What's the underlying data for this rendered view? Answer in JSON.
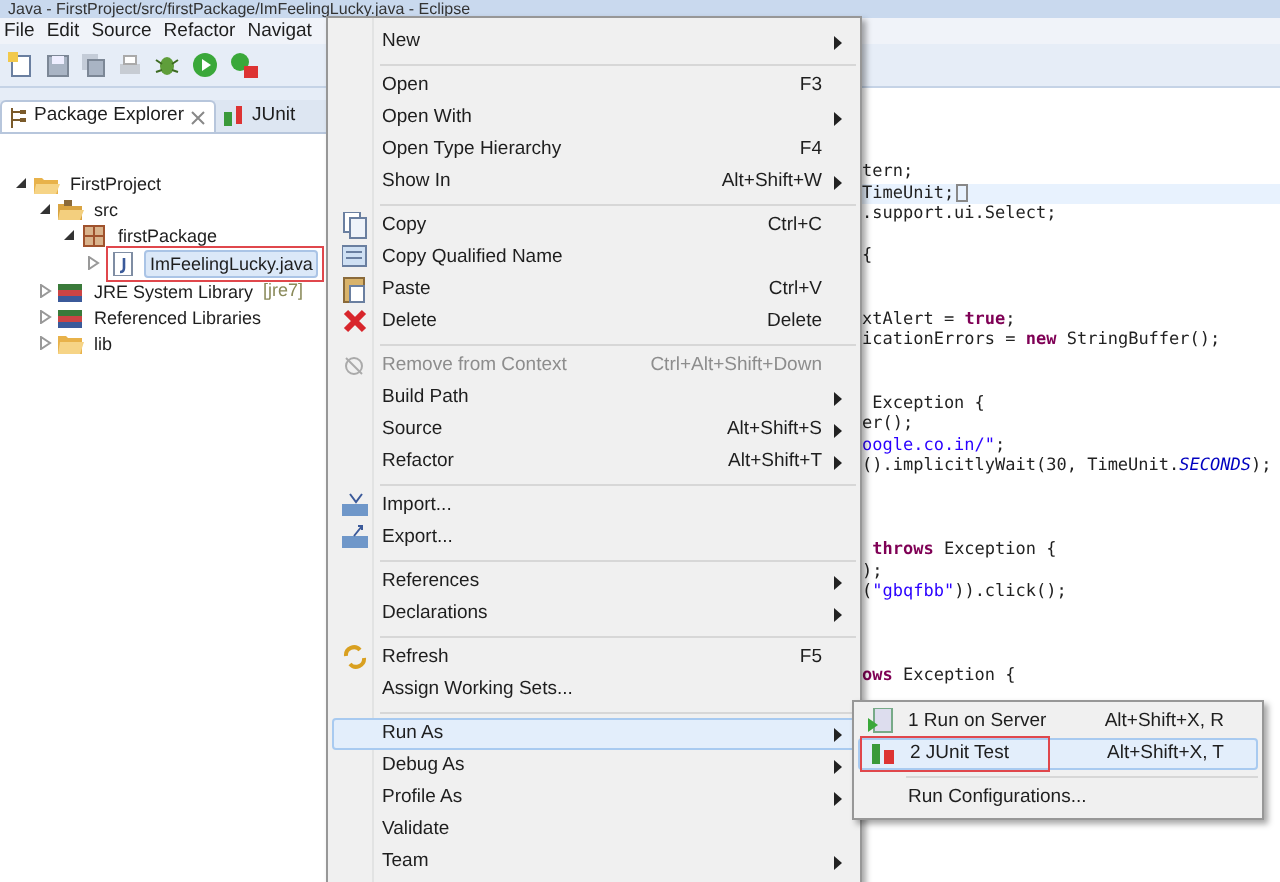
{
  "window": {
    "title": "Java - FirstProject/src/firstPackage/ImFeelingLucky.java - Eclipse"
  },
  "menu_bar": [
    "File",
    "Edit",
    "Source",
    "Refactor",
    "Navigat"
  ],
  "package_explorer": {
    "tabs": [
      {
        "label": "Package Explorer",
        "selected": true
      },
      {
        "label": "JUnit",
        "selected": false
      }
    ],
    "tree": [
      {
        "kind": "project",
        "label": "FirstProject",
        "expanded": true,
        "children": [
          {
            "kind": "source-folder",
            "label": "src",
            "expanded": true,
            "children": [
              {
                "kind": "package",
                "label": "firstPackage",
                "expanded": true,
                "children": [
                  {
                    "kind": "java-file",
                    "label": "ImFeelingLucky.java",
                    "expanded": false,
                    "selected": true,
                    "outlined": true
                  }
                ]
              }
            ]
          },
          {
            "kind": "library",
            "label": "JRE System Library",
            "decoration": "[jre7]",
            "expanded": false
          },
          {
            "kind": "library",
            "label": "Referenced Libraries",
            "expanded": false
          },
          {
            "kind": "folder",
            "label": "lib",
            "expanded": false
          }
        ]
      }
    ]
  },
  "editor": {
    "lines": [
      {
        "tokens": [
          {
            "kind": "plain",
            "text": "tern;"
          }
        ]
      },
      {
        "current": true,
        "tokens": [
          {
            "kind": "plain",
            "text": "TimeUnit;"
          }
        ]
      },
      {
        "tokens": [
          {
            "kind": "plain",
            "text": ".support.ui.Select;"
          }
        ]
      },
      {
        "blank": true
      },
      {
        "tokens": [
          {
            "kind": "plain",
            "text": "{"
          }
        ]
      },
      {
        "blank": true
      },
      {
        "blank": true
      },
      {
        "tokens": [
          {
            "kind": "plain",
            "text": "xtAlert = "
          },
          {
            "kind": "keyword",
            "text": "true"
          },
          {
            "kind": "plain",
            "text": ";"
          }
        ]
      },
      {
        "tokens": [
          {
            "kind": "plain",
            "text": "icationErrors = "
          },
          {
            "kind": "keyword",
            "text": "new"
          },
          {
            "kind": "plain",
            "text": " StringBuffer();"
          }
        ]
      },
      {
        "blank": true
      },
      {
        "blank": true
      },
      {
        "tokens": [
          {
            "kind": "plain",
            "text": " Exception {"
          }
        ]
      },
      {
        "tokens": [
          {
            "kind": "plain",
            "text": "er();"
          }
        ]
      },
      {
        "tokens": [
          {
            "kind": "string",
            "text": "oogle.co.in/\""
          },
          {
            "kind": "plain",
            "text": ";"
          }
        ]
      },
      {
        "tokens": [
          {
            "kind": "plain",
            "text": "().implicitlyWait(30, TimeUnit."
          },
          {
            "kind": "constant",
            "text": "SECONDS"
          },
          {
            "kind": "plain",
            "text": ");"
          }
        ]
      },
      {
        "blank": true
      },
      {
        "blank": true
      },
      {
        "blank": true
      },
      {
        "tokens": [
          {
            "kind": "keyword",
            "text": " throws"
          },
          {
            "kind": "plain",
            "text": " Exception {"
          }
        ]
      },
      {
        "tokens": [
          {
            "kind": "plain",
            "text": ");"
          }
        ]
      },
      {
        "tokens": [
          {
            "kind": "plain",
            "text": "("
          },
          {
            "kind": "string",
            "text": "\"gbqfbb\""
          },
          {
            "kind": "plain",
            "text": ")).click();"
          }
        ]
      },
      {
        "blank": true
      },
      {
        "blank": true
      },
      {
        "blank": true
      },
      {
        "tokens": [
          {
            "kind": "keyword",
            "text": "ows"
          },
          {
            "kind": "plain",
            "text": " Exception {"
          }
        ]
      }
    ]
  },
  "context_menu": {
    "items": [
      {
        "kind": "item",
        "label": "New",
        "submenu": true
      },
      {
        "kind": "separator"
      },
      {
        "kind": "item",
        "label": "Open",
        "shortcut": "F3"
      },
      {
        "kind": "item",
        "label": "Open With",
        "submenu": true
      },
      {
        "kind": "item",
        "label": "Open Type Hierarchy",
        "shortcut": "F4"
      },
      {
        "kind": "item",
        "label": "Show In",
        "shortcut": "Alt+Shift+W",
        "submenu": true
      },
      {
        "kind": "separator"
      },
      {
        "kind": "item",
        "label": "Copy",
        "shortcut": "Ctrl+C"
      },
      {
        "kind": "item",
        "label": "Copy Qualified Name"
      },
      {
        "kind": "item",
        "label": "Paste",
        "shortcut": "Ctrl+V"
      },
      {
        "kind": "item",
        "label": "Delete",
        "shortcut": "Delete"
      },
      {
        "kind": "separator"
      },
      {
        "kind": "item",
        "label": "Remove from Context",
        "shortcut": "Ctrl+Alt+Shift+Down",
        "disabled": true
      },
      {
        "kind": "item",
        "label": "Build Path",
        "submenu": true
      },
      {
        "kind": "item",
        "label": "Source",
        "shortcut": "Alt+Shift+S",
        "submenu": true
      },
      {
        "kind": "item",
        "label": "Refactor",
        "shortcut": "Alt+Shift+T",
        "submenu": true
      },
      {
        "kind": "separator"
      },
      {
        "kind": "item",
        "label": "Import..."
      },
      {
        "kind": "item",
        "label": "Export..."
      },
      {
        "kind": "separator"
      },
      {
        "kind": "item",
        "label": "References",
        "submenu": true
      },
      {
        "kind": "item",
        "label": "Declarations",
        "submenu": true
      },
      {
        "kind": "separator"
      },
      {
        "kind": "item",
        "label": "Refresh",
        "shortcut": "F5"
      },
      {
        "kind": "item",
        "label": "Assign Working Sets..."
      },
      {
        "kind": "separator"
      },
      {
        "kind": "item",
        "label": "Run As",
        "submenu": true,
        "selected": true
      },
      {
        "kind": "item",
        "label": "Debug As",
        "submenu": true
      },
      {
        "kind": "item",
        "label": "Profile As",
        "submenu": true
      },
      {
        "kind": "item",
        "label": "Validate"
      },
      {
        "kind": "item",
        "label": "Team",
        "submenu": true
      }
    ]
  },
  "run_as_submenu": {
    "items": [
      {
        "kind": "item",
        "label": "1 Run on Server",
        "shortcut": "Alt+Shift+X, R",
        "selected": false
      },
      {
        "kind": "item",
        "label": "2 JUnit Test",
        "shortcut": "Alt+Shift+X, T",
        "selected": true,
        "outlined": true
      },
      {
        "kind": "separator"
      },
      {
        "kind": "item",
        "label": "Run Configurations...",
        "selected": false
      }
    ]
  }
}
